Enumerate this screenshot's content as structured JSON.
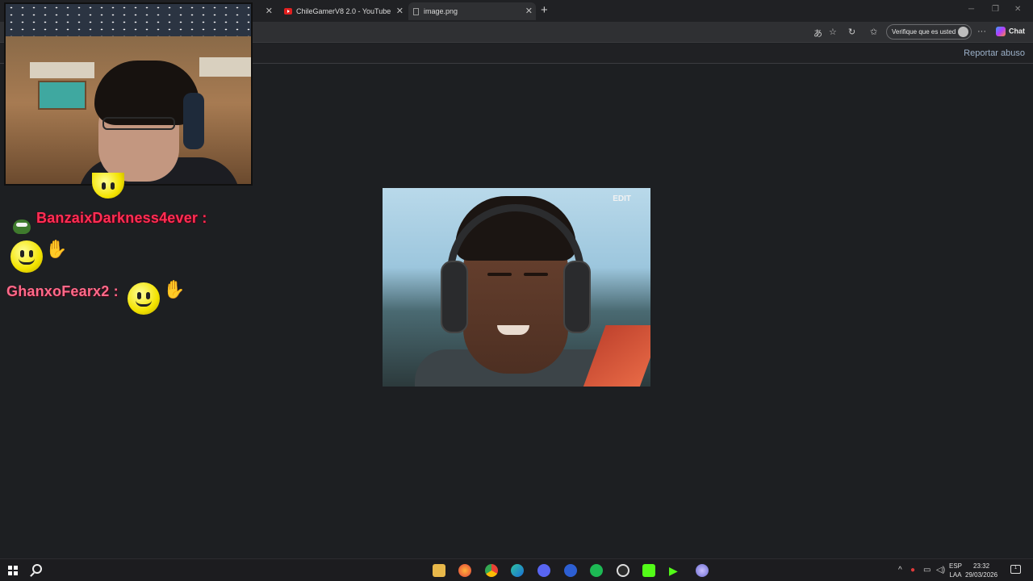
{
  "browser": {
    "tabs": [
      {
        "title": ""
      },
      {
        "title": "ChileGamerV8 2.0 - YouTube"
      },
      {
        "title": "image.png"
      }
    ],
    "verify_label": "Verifique que es usted",
    "chat_label": "Chat",
    "report_label": "Reportar abuso"
  },
  "viewer": {
    "image_overlay_text": "EDIT"
  },
  "stream_chat": {
    "messages": [
      {
        "user": "BanzaixDarkness4ever :"
      },
      {
        "user": "GhanxoFearx2 :"
      }
    ]
  },
  "taskbar": {
    "lang_top": "ESP",
    "lang_bottom": "LAA",
    "time": "23:32",
    "date": "29/03/2026",
    "notif_count": "1"
  },
  "colors": {
    "username": "#ff2f55",
    "background": "#1d1f22",
    "report_link": "#9bb0c8"
  }
}
